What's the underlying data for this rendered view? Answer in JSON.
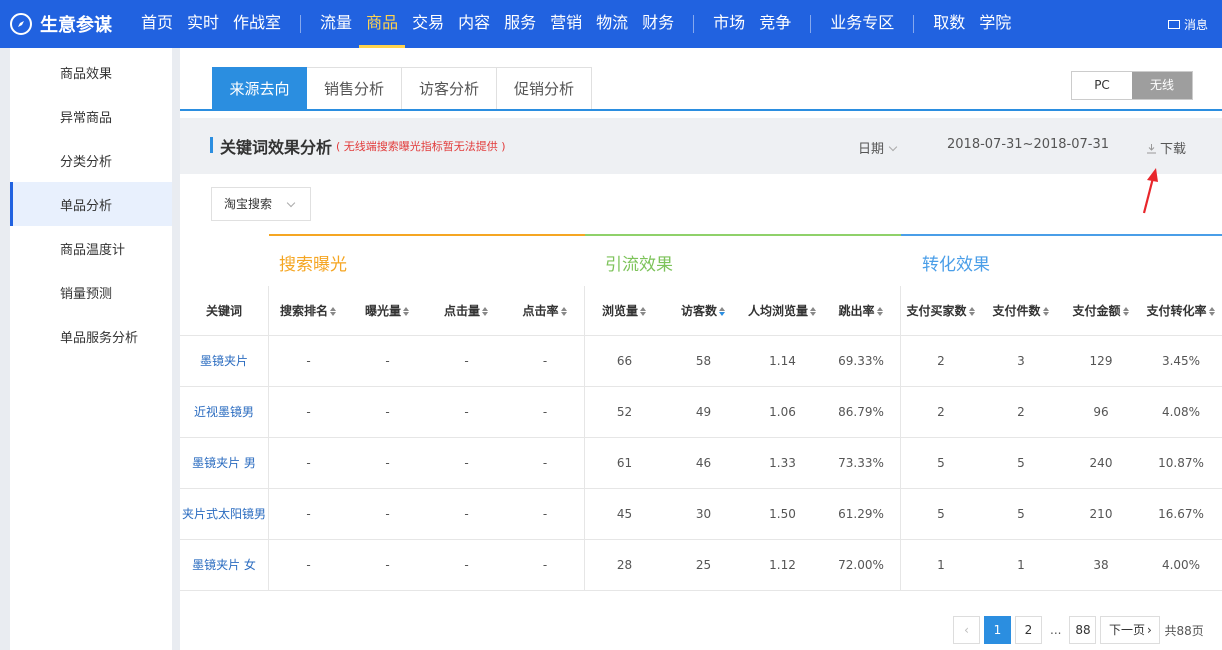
{
  "brand": {
    "name": "生意参谋",
    "logo_icon": "compass-icon"
  },
  "nav": {
    "group1": [
      "首页",
      "实时",
      "作战室"
    ],
    "group2": [
      "流量",
      "商品",
      "交易",
      "内容",
      "服务",
      "营销",
      "物流",
      "财务"
    ],
    "group3": [
      "市场",
      "竞争"
    ],
    "group4": [
      "业务专区"
    ],
    "group5": [
      "取数",
      "学院"
    ],
    "active": "商品",
    "message": "消息"
  },
  "sidebar": {
    "items": [
      "商品效果",
      "异常商品",
      "分类分析",
      "单品分析",
      "商品温度计",
      "销量预测",
      "单品服务分析"
    ],
    "active_index": 3
  },
  "tabs": [
    "来源去向",
    "销售分析",
    "访客分析",
    "促销分析"
  ],
  "device_toggle": {
    "options": [
      "PC",
      "无线"
    ],
    "active": "无线"
  },
  "section": {
    "title": "关键词效果分析",
    "note": "( 无线端搜索曝光指标暂无法提供 )",
    "date_label": "日期",
    "date_range": "2018-07-31~2018-07-31",
    "download": "下载"
  },
  "search_select": "淘宝搜索",
  "table": {
    "groups": [
      "搜索曝光",
      "引流效果",
      "转化效果"
    ],
    "columns": [
      "关键词",
      "搜索排名",
      "曝光量",
      "点击量",
      "点击率",
      "浏览量",
      "访客数",
      "人均浏览量",
      "跳出率",
      "支付买家数",
      "支付件数",
      "支付金额",
      "支付转化率"
    ],
    "rows": [
      [
        "墨镜夹片",
        "-",
        "-",
        "-",
        "-",
        "66",
        "58",
        "1.14",
        "69.33%",
        "2",
        "3",
        "129",
        "3.45%"
      ],
      [
        "近视墨镜男",
        "-",
        "-",
        "-",
        "-",
        "52",
        "49",
        "1.06",
        "86.79%",
        "2",
        "2",
        "96",
        "4.08%"
      ],
      [
        "墨镜夹片 男",
        "-",
        "-",
        "-",
        "-",
        "61",
        "46",
        "1.33",
        "73.33%",
        "5",
        "5",
        "240",
        "10.87%"
      ],
      [
        "夹片式太阳镜男",
        "-",
        "-",
        "-",
        "-",
        "45",
        "30",
        "1.50",
        "61.29%",
        "5",
        "5",
        "210",
        "16.67%"
      ],
      [
        "墨镜夹片 女",
        "-",
        "-",
        "-",
        "-",
        "28",
        "25",
        "1.12",
        "72.00%",
        "1",
        "1",
        "38",
        "4.00%"
      ]
    ]
  },
  "pagination": {
    "prev": "‹",
    "pages": [
      "1",
      "2"
    ],
    "dots": "...",
    "last": "88",
    "next": "下一页",
    "total": "共88页"
  },
  "colors": {
    "nav_bg": "#2162e0",
    "accent": "#2b8ee0",
    "active_nav": "#ffd34d",
    "group_search": "#f5a623",
    "group_traffic": "#7dc35a",
    "group_conversion": "#4a9ee8",
    "note_red": "#e23b3b",
    "annotation_red": "#e8262b"
  }
}
